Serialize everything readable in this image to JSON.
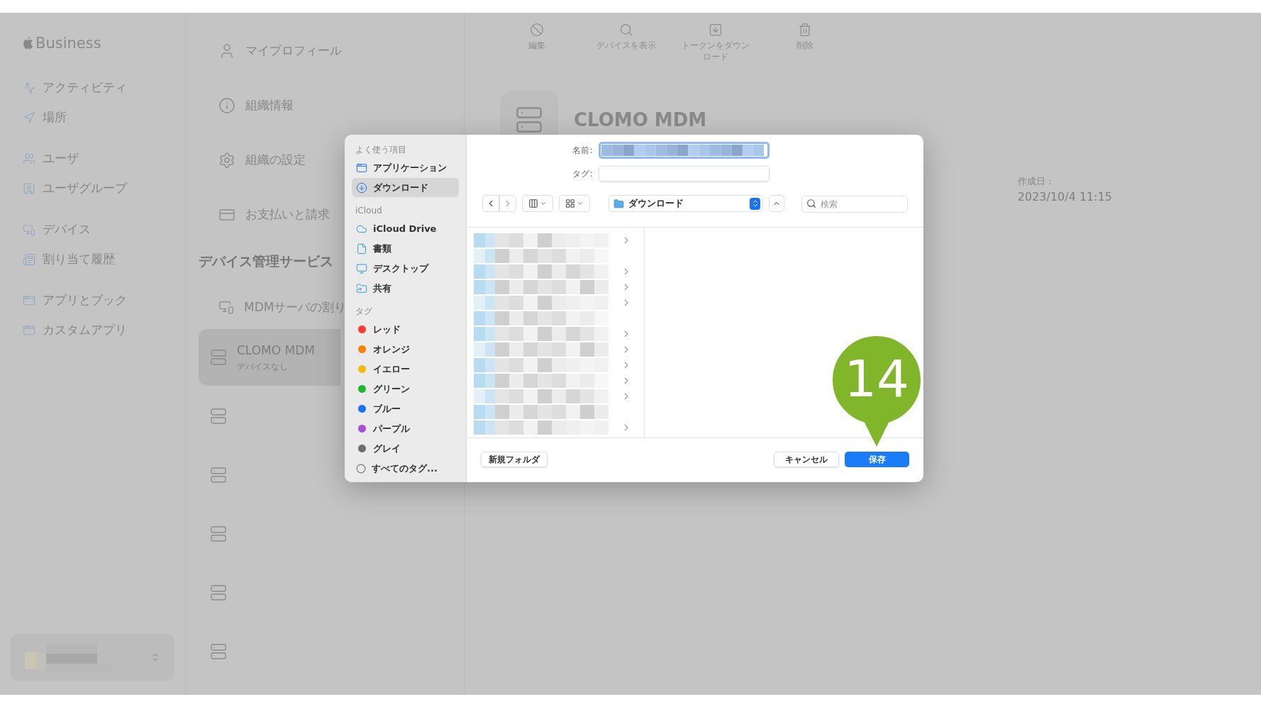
{
  "app_logo": "Business",
  "sidebar": {
    "groups": [
      [
        {
          "label": "アクティビティ"
        },
        {
          "label": "場所"
        }
      ],
      [
        {
          "label": "ユーザ"
        },
        {
          "label": "ユーザグループ"
        }
      ],
      [
        {
          "label": "デバイス"
        },
        {
          "label": "割り当て履歴"
        }
      ],
      [
        {
          "label": "アプリとブック"
        },
        {
          "label": "カスタムアプリ"
        }
      ]
    ]
  },
  "settings_menu": [
    {
      "label": "マイプロフィール"
    },
    {
      "label": "組織情報"
    },
    {
      "label": "組織の設定"
    },
    {
      "label": "お支払いと請求"
    }
  ],
  "device_services": {
    "title": "デバイス管理サービス",
    "assign_label": "MDMサーバの割り",
    "servers": [
      {
        "name": "CLOMO MDM",
        "subtitle": "デバイスなし",
        "selected": true
      },
      {
        "selected": false
      },
      {
        "selected": false
      },
      {
        "selected": false
      },
      {
        "selected": false
      },
      {
        "selected": false
      }
    ]
  },
  "toolbar": [
    {
      "label": "編集"
    },
    {
      "label": "デバイスを表示"
    },
    {
      "label": "トークンをダウンロード"
    },
    {
      "label": "削除"
    }
  ],
  "detail": {
    "heading": "CLOMO MDM",
    "created_label": "作成日：",
    "created_value": "2023/10/4 11:15"
  },
  "save_dialog": {
    "sidebar": [
      {
        "title": "よく使う項目",
        "items": [
          {
            "label": "アプリケーション",
            "selected": false
          },
          {
            "label": "ダウンロード",
            "selected": true
          }
        ]
      },
      {
        "title": "iCloud",
        "items": [
          {
            "label": "iCloud Drive",
            "selected": false
          },
          {
            "label": "書類",
            "selected": false
          },
          {
            "label": "デスクトップ",
            "selected": false
          },
          {
            "label": "共有",
            "selected": false
          }
        ]
      },
      {
        "title": "タグ",
        "items": [
          {
            "label": "レッド",
            "kind": "tag",
            "color": "#ff3b30"
          },
          {
            "label": "オレンジ",
            "kind": "tag",
            "color": "#f5820b"
          },
          {
            "label": "イエロー",
            "kind": "tag",
            "color": "#f2b90c"
          },
          {
            "label": "グリーン",
            "kind": "tag",
            "color": "#1fb82a"
          },
          {
            "label": "ブルー",
            "kind": "tag",
            "color": "#1a73f5"
          },
          {
            "label": "パープル",
            "kind": "tag",
            "color": "#a550d6"
          },
          {
            "label": "グレイ",
            "kind": "tag",
            "color": "#6e6e72"
          },
          {
            "label": "すべてのタグ...",
            "kind": "all"
          }
        ]
      }
    ],
    "name_label": "名前:",
    "tags_label": "タグ:",
    "location": "ダウンロード",
    "search_placeholder": "検索",
    "new_folder_button": "新規フォルダ",
    "cancel_button": "キャンセル",
    "save_button": "保存"
  },
  "step_callout": "14"
}
